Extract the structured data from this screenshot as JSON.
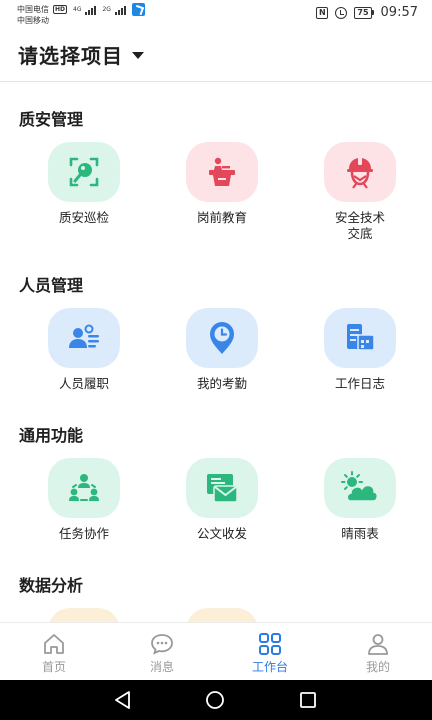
{
  "status_bar": {
    "carrier1": "中国电信",
    "carrier1_badge": "HD",
    "carrier1_net": "4G",
    "carrier2": "中国移动",
    "carrier2_net": "2G",
    "nfc": "N",
    "battery": "75",
    "time": "09:57"
  },
  "header": {
    "project_title": "请选择项目"
  },
  "sections": {
    "quality": {
      "title": "质安管理",
      "items": [
        {
          "label": "质安巡检",
          "icon": "search-inspect-icon",
          "bg": "#dcf5ea"
        },
        {
          "label": "岗前教育",
          "icon": "lectern-icon",
          "bg": "#fde3e6"
        },
        {
          "label": "安全技术\n交底",
          "icon": "hardhat-worker-icon",
          "bg": "#fde3e6"
        }
      ]
    },
    "personnel": {
      "title": "人员管理",
      "items": [
        {
          "label": "人员履职",
          "icon": "person-card-icon",
          "bg": "#dcebfc"
        },
        {
          "label": "我的考勤",
          "icon": "clock-pin-icon",
          "bg": "#dcebfc"
        },
        {
          "label": "工作日志",
          "icon": "log-calendar-icon",
          "bg": "#dcebfc"
        }
      ]
    },
    "common": {
      "title": "通用功能",
      "items": [
        {
          "label": "任务协作",
          "icon": "team-collab-icon",
          "bg": "#dcf5ea"
        },
        {
          "label": "公文收发",
          "icon": "document-mail-icon",
          "bg": "#dcf5ea"
        },
        {
          "label": "晴雨表",
          "icon": "sun-cloud-icon",
          "bg": "#dcf5ea"
        }
      ]
    },
    "analysis": {
      "title": "数据分析"
    }
  },
  "bottom_nav": {
    "items": [
      {
        "label": "首页",
        "icon": "home-icon",
        "active": false
      },
      {
        "label": "消息",
        "icon": "chat-icon",
        "active": false
      },
      {
        "label": "工作台",
        "icon": "grid-icon",
        "active": true
      },
      {
        "label": "我的",
        "icon": "user-icon",
        "active": false
      }
    ]
  },
  "colors": {
    "green_icon": "#2bb77e",
    "red_icon": "#e2475a",
    "blue_icon": "#3a86e8",
    "active_nav": "#2a7be4"
  }
}
